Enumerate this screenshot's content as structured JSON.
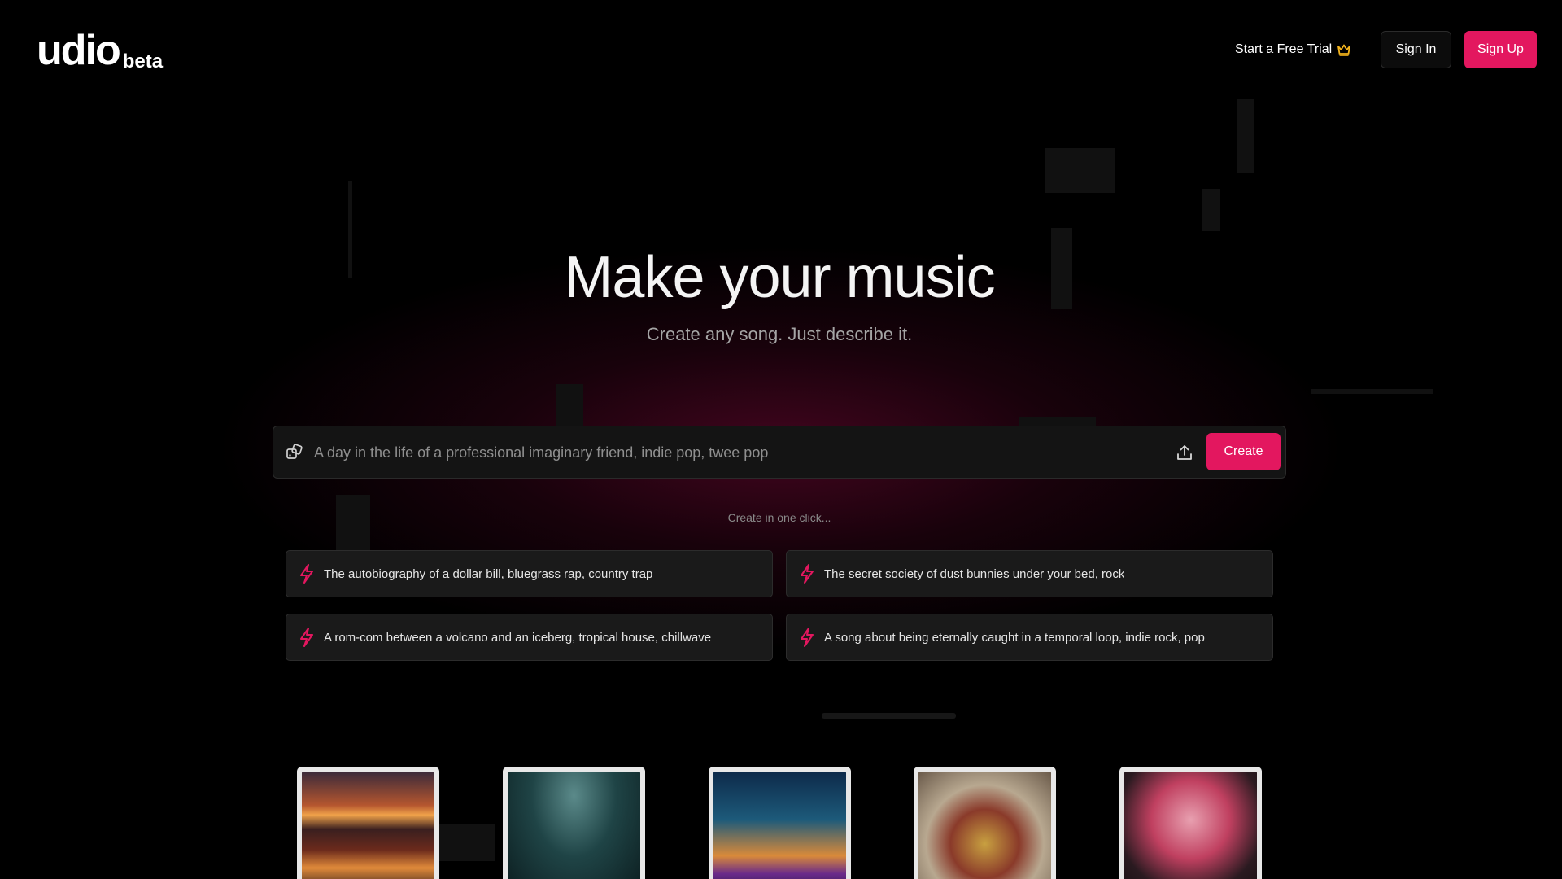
{
  "header": {
    "logo_text": "udio",
    "logo_badge": "beta",
    "trial_label": "Start a Free Trial",
    "sign_in_label": "Sign In",
    "sign_up_label": "Sign Up"
  },
  "hero": {
    "title": "Make your music",
    "subtitle": "Create any song. Just describe it."
  },
  "prompt": {
    "placeholder": "A day in the life of a professional imaginary friend, indie pop, twee pop",
    "value": "",
    "create_label": "Create"
  },
  "one_click_label": "Create in one click...",
  "suggestions": [
    "The autobiography of a dollar bill, bluegrass rap, country trap",
    "The secret society of dust bunnies under your bed, rock",
    "A rom-com between a volcano and an iceberg, tropical house, chillwave",
    "A song about being eternally caught in a temporal loop, indie rock, pop"
  ],
  "icons": {
    "dice": "dice-icon",
    "upload": "upload-icon",
    "bolt": "lightning-bolt-icon",
    "crown": "crown-icon"
  },
  "colors": {
    "accent": "#e3175f",
    "crown": "#f2b21c",
    "background": "#000000"
  }
}
